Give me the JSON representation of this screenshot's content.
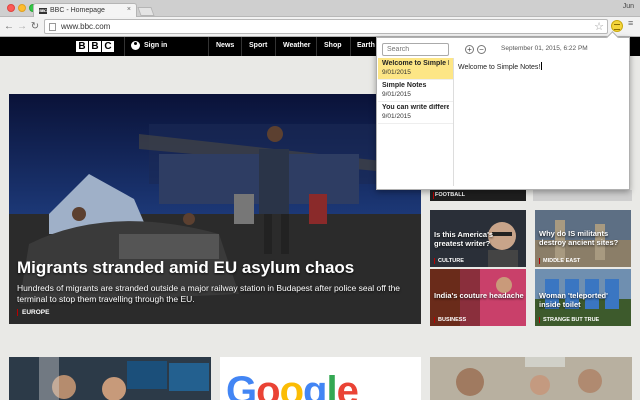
{
  "browser": {
    "tab_title": "BBC - Homepage",
    "tab_favicon": "BBC",
    "user_label": "Jun",
    "address": "www.bbc.com"
  },
  "bbc": {
    "logo_letters": [
      "B",
      "B",
      "C"
    ],
    "signin_label": "Sign in",
    "nav": [
      "News",
      "Sport",
      "Weather",
      "Shop",
      "Earth"
    ],
    "hero": {
      "title": "Migrants stranded amid EU asylum chaos",
      "summary": "Hundreds of migrants are stranded outside a major railway station in Budapest after police seal off the terminal to stop them travelling through the EU.",
      "tag": "EUROPE"
    },
    "football_tag": "FOOTBALL",
    "cards": [
      {
        "title": "Is this America's greatest writer?",
        "tag": "CULTURE"
      },
      {
        "title": "Why do IS militants destroy ancient sites?",
        "tag": "MIDDLE EAST"
      },
      {
        "title": "India's couture headache",
        "tag": "BUSINESS"
      },
      {
        "title": "Woman 'teleported' inside toilet",
        "tag": "STRANGE BUT TRUE"
      }
    ],
    "google_letters": [
      "G",
      "o",
      "o",
      "g",
      "l",
      "e"
    ]
  },
  "notes": {
    "search_placeholder": "Search",
    "add_symbol": "+",
    "remove_symbol": "−",
    "current_date": "September 01, 2015, 6:22 PM",
    "items": [
      {
        "title": "Welcome to Simple Notes!",
        "date": "9/01/2015"
      },
      {
        "title": "Simple Notes",
        "date": "9/01/2015"
      },
      {
        "title": "You can write different notes",
        "date": "9/01/2015"
      }
    ],
    "editor_text": "Welcome to Simple Notes!"
  },
  "colors": {
    "bbc_black": "#000000",
    "bbc_red": "#b80000",
    "note_highlight": "#fde686",
    "google_blue": "#4285f4",
    "google_red": "#ea4335",
    "google_yellow": "#fbbc05",
    "google_green": "#34a853"
  },
  "icons": {
    "back": "arrow-left",
    "forward": "arrow-right",
    "reload": "reload",
    "bookmark": "star",
    "menu": "hamburger",
    "extension": "simple-notes"
  }
}
